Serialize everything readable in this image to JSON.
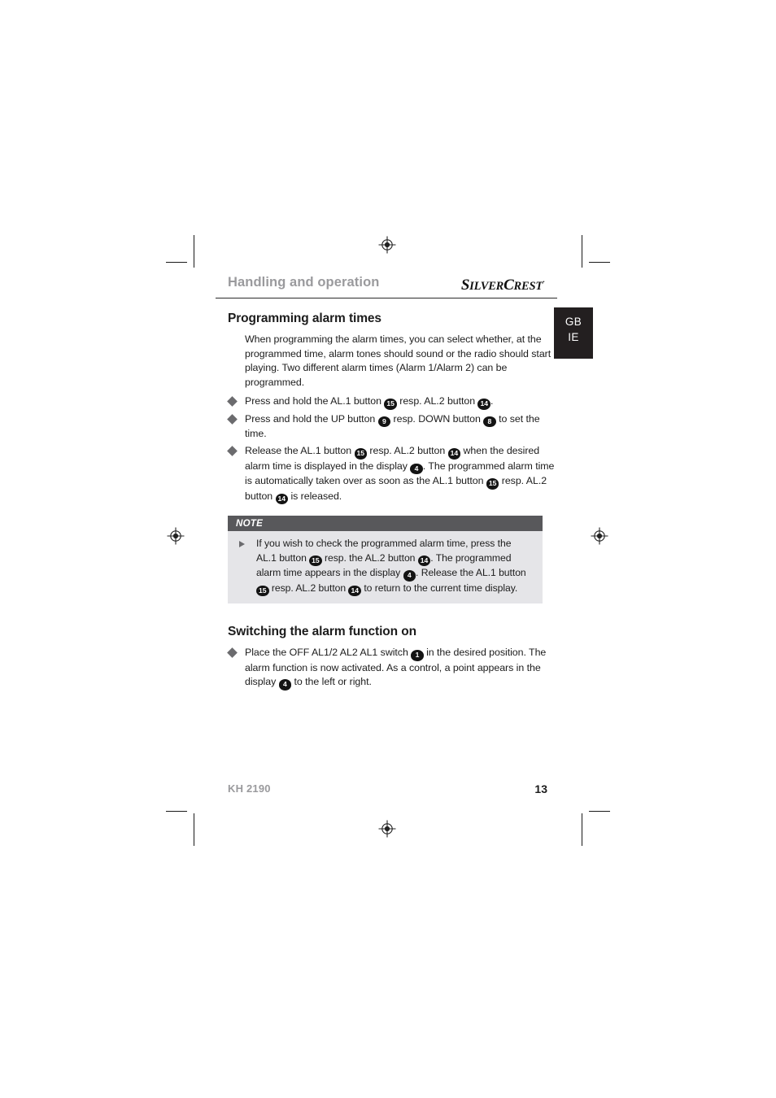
{
  "header": {
    "section_title": "Handling and operation",
    "brand": {
      "part1_big": "S",
      "part1_small": "ILVER",
      "part2_big": "C",
      "part2_small": "REST",
      "trademark": "·"
    }
  },
  "lang_tab": {
    "line1": "GB",
    "line2": "IE"
  },
  "sections": [
    {
      "heading": "Programming alarm times",
      "paragraph": "When programming the alarm times, you can select whether, at the programmed time, alarm tones should sound or the radio should start playing. Two different alarm times (Alarm 1/Alarm 2) can be programmed.",
      "bullets": [
        {
          "parts": [
            {
              "t": "text",
              "v": "Press and hold the AL.1 button "
            },
            {
              "t": "badge",
              "v": "15"
            },
            {
              "t": "text",
              "v": " resp. AL.2 button "
            },
            {
              "t": "badge",
              "v": "14"
            },
            {
              "t": "text",
              "v": "."
            }
          ]
        },
        {
          "parts": [
            {
              "t": "text",
              "v": "Press and hold the UP button "
            },
            {
              "t": "badge",
              "v": "9"
            },
            {
              "t": "text",
              "v": " resp. DOWN button "
            },
            {
              "t": "badge",
              "v": "8"
            },
            {
              "t": "text",
              "v": " to set the time."
            }
          ]
        },
        {
          "parts": [
            {
              "t": "text",
              "v": "Release the AL.1 button "
            },
            {
              "t": "badge",
              "v": "15"
            },
            {
              "t": "text",
              "v": " resp. AL.2 button "
            },
            {
              "t": "badge",
              "v": "14"
            },
            {
              "t": "text",
              "v": " when the desired alarm time is displayed in the display "
            },
            {
              "t": "badge",
              "v": "4"
            },
            {
              "t": "text",
              "v": ". The programmed alarm time is automatically taken over as soon as the AL.1 button "
            },
            {
              "t": "badge",
              "v": "15"
            },
            {
              "t": "text",
              "v": " resp. AL.2 button "
            },
            {
              "t": "badge",
              "v": "14"
            },
            {
              "t": "text",
              "v": " is released."
            }
          ]
        }
      ]
    }
  ],
  "note": {
    "title": "NOTE",
    "items": [
      {
        "parts": [
          {
            "t": "text",
            "v": "If you wish to check the programmed alarm time, press the AL.1 button "
          },
          {
            "t": "badge",
            "v": "15"
          },
          {
            "t": "text",
            "v": " resp. the AL.2 button "
          },
          {
            "t": "badge",
            "v": "14"
          },
          {
            "t": "text",
            "v": ". The programmed alarm time appears in the display "
          },
          {
            "t": "badge",
            "v": "4"
          },
          {
            "t": "text",
            "v": ". Release the AL.1 button "
          },
          {
            "t": "badge",
            "v": "15"
          },
          {
            "t": "text",
            "v": " resp. AL.2 button "
          },
          {
            "t": "badge",
            "v": "14"
          },
          {
            "t": "text",
            "v": " to return to the current time display."
          }
        ]
      }
    ]
  },
  "section2": {
    "heading": "Switching the alarm function on",
    "bullets": [
      {
        "parts": [
          {
            "t": "text",
            "v": "Place the OFF AL1/2 AL2 AL1 switch "
          },
          {
            "t": "badge",
            "v": "1"
          },
          {
            "t": "text",
            "v": " in the desired position. The alarm function is now activated. As a control, a point appears in the display "
          },
          {
            "t": "badge",
            "v": "4"
          },
          {
            "t": "text",
            "v": " to the left or right."
          }
        ]
      }
    ]
  },
  "footer": {
    "model": "KH 2190",
    "page_number": "13"
  },
  "colors": {
    "header_gray": "#9a9a9d",
    "note_header_bg": "#58585b",
    "note_body_bg": "#e5e5e8",
    "badge_bg": "#141414",
    "lang_tab_bg": "#231f20",
    "bullet_gray": "#6b6b6e"
  }
}
